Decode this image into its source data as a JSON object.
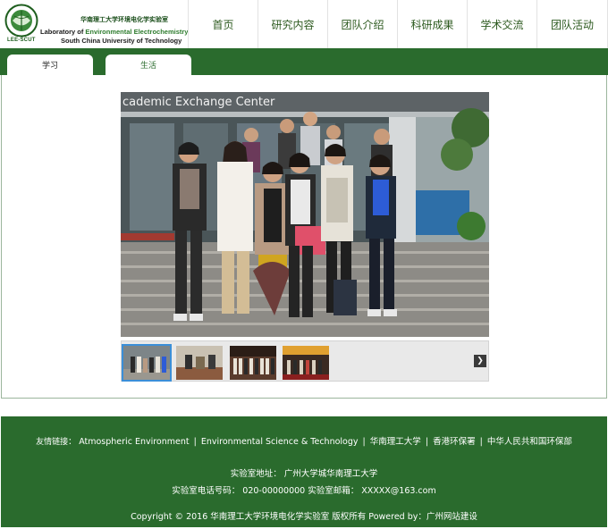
{
  "logo": {
    "tag": "LEE-SCUT",
    "cn": "华南理工大学环境电化学实验室",
    "en_prefix": "Laboratory of ",
    "en_highlight": "Environmental Electrochemistry",
    "en_line2": "South China University of Technology"
  },
  "nav": [
    "首页",
    "研究内容",
    "团队介绍",
    "科研成果",
    "学术交流",
    "团队活动"
  ],
  "tabs": {
    "study": "学习",
    "life": "生活"
  },
  "photo": {
    "sign_text": "cademic Exchange Center"
  },
  "footer": {
    "links_label": "友情链接：",
    "links": [
      "Atmospheric Environment",
      "Environmental Science & Technology",
      "华南理工大学",
      "香港环保署",
      "中华人民共和国环保部"
    ],
    "separator": "|",
    "address": "实验室地址： 广州大学城华南理工大学",
    "phone": "实验室电话号码： 020-00000000 实验室邮箱： XXXXX@163.com",
    "copyright": "Copyright © 2016 华南理工大学环境电化学实验室 版权所有 Powered by：广州网站建设"
  },
  "colors": {
    "brand_green": "#2a6b2d",
    "thumb_highlight": "#3b8fd8"
  },
  "icons": {
    "prev": "chevron-left-icon",
    "next": "chevron-right-icon"
  }
}
